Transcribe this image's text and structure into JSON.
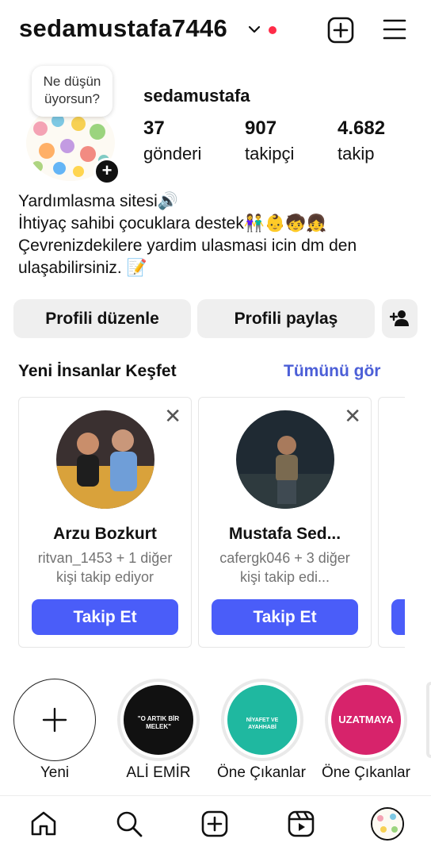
{
  "header": {
    "username": "sedamustafa7446"
  },
  "profile": {
    "note": "Ne düşün üyorsun?",
    "display_name": "sedamustafa",
    "stats": [
      {
        "value": "37",
        "label": "gönderi"
      },
      {
        "value": "907",
        "label": "takipçi"
      },
      {
        "value": "4.682",
        "label": "takip"
      }
    ],
    "bio_lines": [
      "Yardımlasma sitesi🔊",
      "İhtiyaç sahibi çocuklara destek👫👶🧒👧",
      "Çevrenizdekilere yardim ulasmasi icin dm den",
      "ulaşabilirsiniz. 📝"
    ]
  },
  "actions": {
    "edit": "Profili düzenle",
    "share": "Profili paylaş"
  },
  "discover": {
    "title": "Yeni İnsanlar Keşfet",
    "see_all": "Tümünü gör",
    "cards": [
      {
        "name": "Arzu Bozkurt",
        "sub": "ritvan_1453 + 1 diğer kişi takip ediyor",
        "button": "Takip Et"
      },
      {
        "name": "Mustafa Sed...",
        "sub": "cafergk046 + 3 diğer kişi takip edi...",
        "button": "Takip Et"
      }
    ]
  },
  "highlights": [
    {
      "label": "Yeni"
    },
    {
      "label": "ALİ EMİR",
      "text": "\"O ARTIK BİR MELEK\""
    },
    {
      "label": "Öne Çıkanlar",
      "text": "NİYAFET VE AYAHHABİ"
    },
    {
      "label": "Öne Çıkanlar",
      "text": "UZATMAYA"
    }
  ],
  "colors": {
    "accent": "#4a5df9",
    "link": "#4c5fd7",
    "notification": "#ff2c48"
  }
}
